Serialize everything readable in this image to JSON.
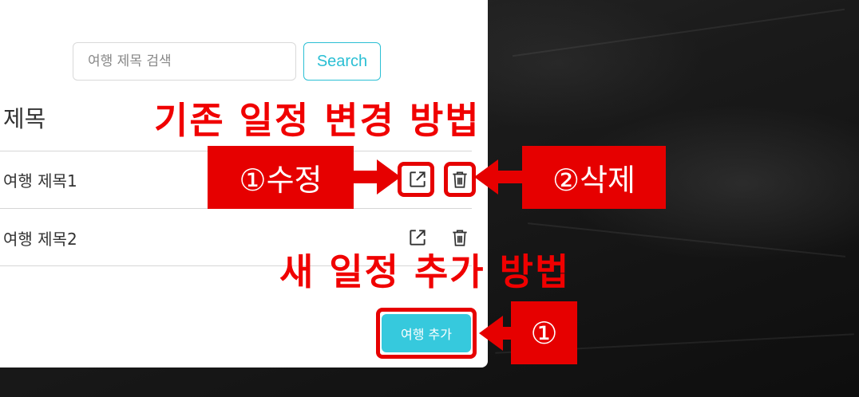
{
  "search": {
    "placeholder": "여행 제목 검색",
    "button_label": "Search"
  },
  "table": {
    "header": "제목",
    "rows": [
      {
        "title": "여행 제목1"
      },
      {
        "title": "여행 제목2"
      }
    ]
  },
  "add_button_label": "여행 추가",
  "annotations": {
    "edit_section_title": "기존 일정 변경 방법",
    "add_section_title": "새 일정 추가 방법",
    "step_edit": "①수정",
    "step_delete": "②삭제",
    "step_add": "①"
  },
  "icons": {
    "edit": "external-edit-icon",
    "delete": "trash-icon"
  },
  "colors": {
    "accent": "#36c9dd",
    "annotation_red": "#e60000"
  }
}
